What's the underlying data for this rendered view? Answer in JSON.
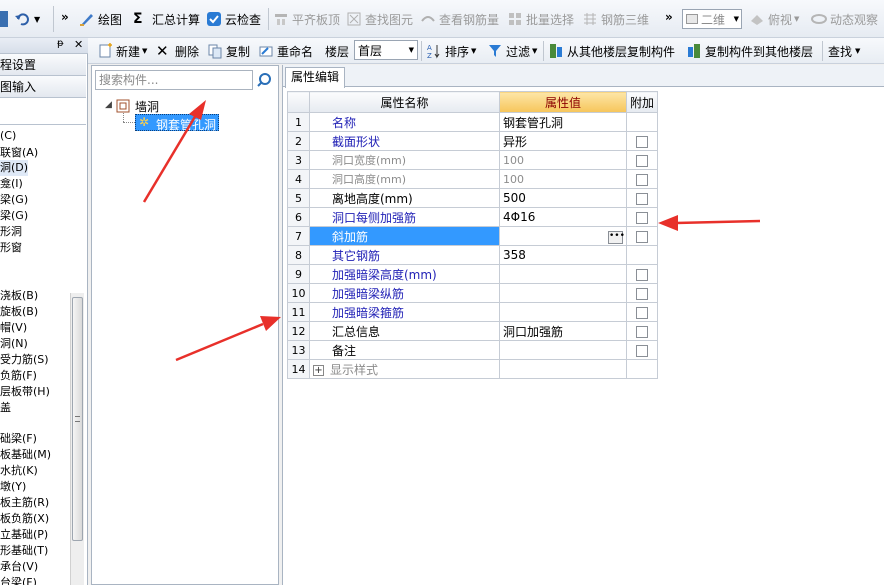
{
  "toolbar1": {
    "overflow": "»",
    "draw": "绘图",
    "summary_calc": "汇总计算",
    "cloud_check": "云检查",
    "align_top": "平齐板顶",
    "find_element": "查找图元",
    "view_rebar": "查看钢筋量",
    "batch_select": "批量选择",
    "rebar_3d": "钢筋三维",
    "overflow2": "»",
    "view_mode": "二维",
    "top_view": "俯视",
    "dynamic_view": "动态观察"
  },
  "toolbar2": {
    "new": "新建",
    "delete": "删除",
    "copy": "复制",
    "rename": "重命名",
    "floor_label": "楼层",
    "floor_value": "首层",
    "sort": "排序",
    "filter": "过滤",
    "copy_from_floor": "从其他楼层复制构件",
    "copy_to_floor": "复制构件到其他楼层",
    "find": "查找"
  },
  "left_strip": {
    "nav_buttons": [
      "程设置",
      "图输入"
    ],
    "items": [
      "(C)",
      "联窗(A)",
      "洞(D)",
      "龛(I)",
      "梁(G)",
      "梁(G)",
      "形洞",
      "形窗",
      "浇板(B)",
      "旋板(B)",
      "帽(V)",
      "洞(N)",
      "受力筋(S)",
      "负筋(F)",
      "层板带(H)",
      "盖",
      "础梁(F)",
      "板基础(M)",
      "水抗(K)",
      "墩(Y)",
      "板主筋(R)",
      "板负筋(X)",
      "立基础(P)",
      "形基础(T)",
      "承台(V)",
      "台梁(F)"
    ]
  },
  "tree": {
    "search_placeholder": "搜索构件...",
    "root": "墙洞",
    "child": "钢套管孔洞"
  },
  "props": {
    "tab": "属性编辑",
    "headers": [
      "属性名称",
      "属性值",
      "附加"
    ],
    "rows": [
      {
        "n": "1",
        "name": "名称",
        "value": "钢套管孔洞"
      },
      {
        "n": "2",
        "name": "截面形状",
        "value": "异形"
      },
      {
        "n": "3",
        "name": "洞口宽度(mm)",
        "value": "100"
      },
      {
        "n": "4",
        "name": "洞口高度(mm)",
        "value": "100"
      },
      {
        "n": "5",
        "name": "离地高度(mm)",
        "value": "500"
      },
      {
        "n": "6",
        "name": "洞口每侧加强筋",
        "value": "4Φ16"
      },
      {
        "n": "7",
        "name": "斜加筋",
        "value": ""
      },
      {
        "n": "8",
        "name": "其它钢筋",
        "value": "358"
      },
      {
        "n": "9",
        "name": "加强暗梁高度(mm)",
        "value": ""
      },
      {
        "n": "10",
        "name": "加强暗梁纵筋",
        "value": ""
      },
      {
        "n": "11",
        "name": "加强暗梁箍筋",
        "value": ""
      },
      {
        "n": "12",
        "name": "汇总信息",
        "value": "洞口加强筋"
      },
      {
        "n": "13",
        "name": "备注",
        "value": ""
      },
      {
        "n": "14",
        "name": "显示样式",
        "value": ""
      }
    ]
  },
  "colors": {
    "annotation_arrow": "#e8302a",
    "selection": "#3399ff",
    "value_header": "#f6c55a"
  }
}
